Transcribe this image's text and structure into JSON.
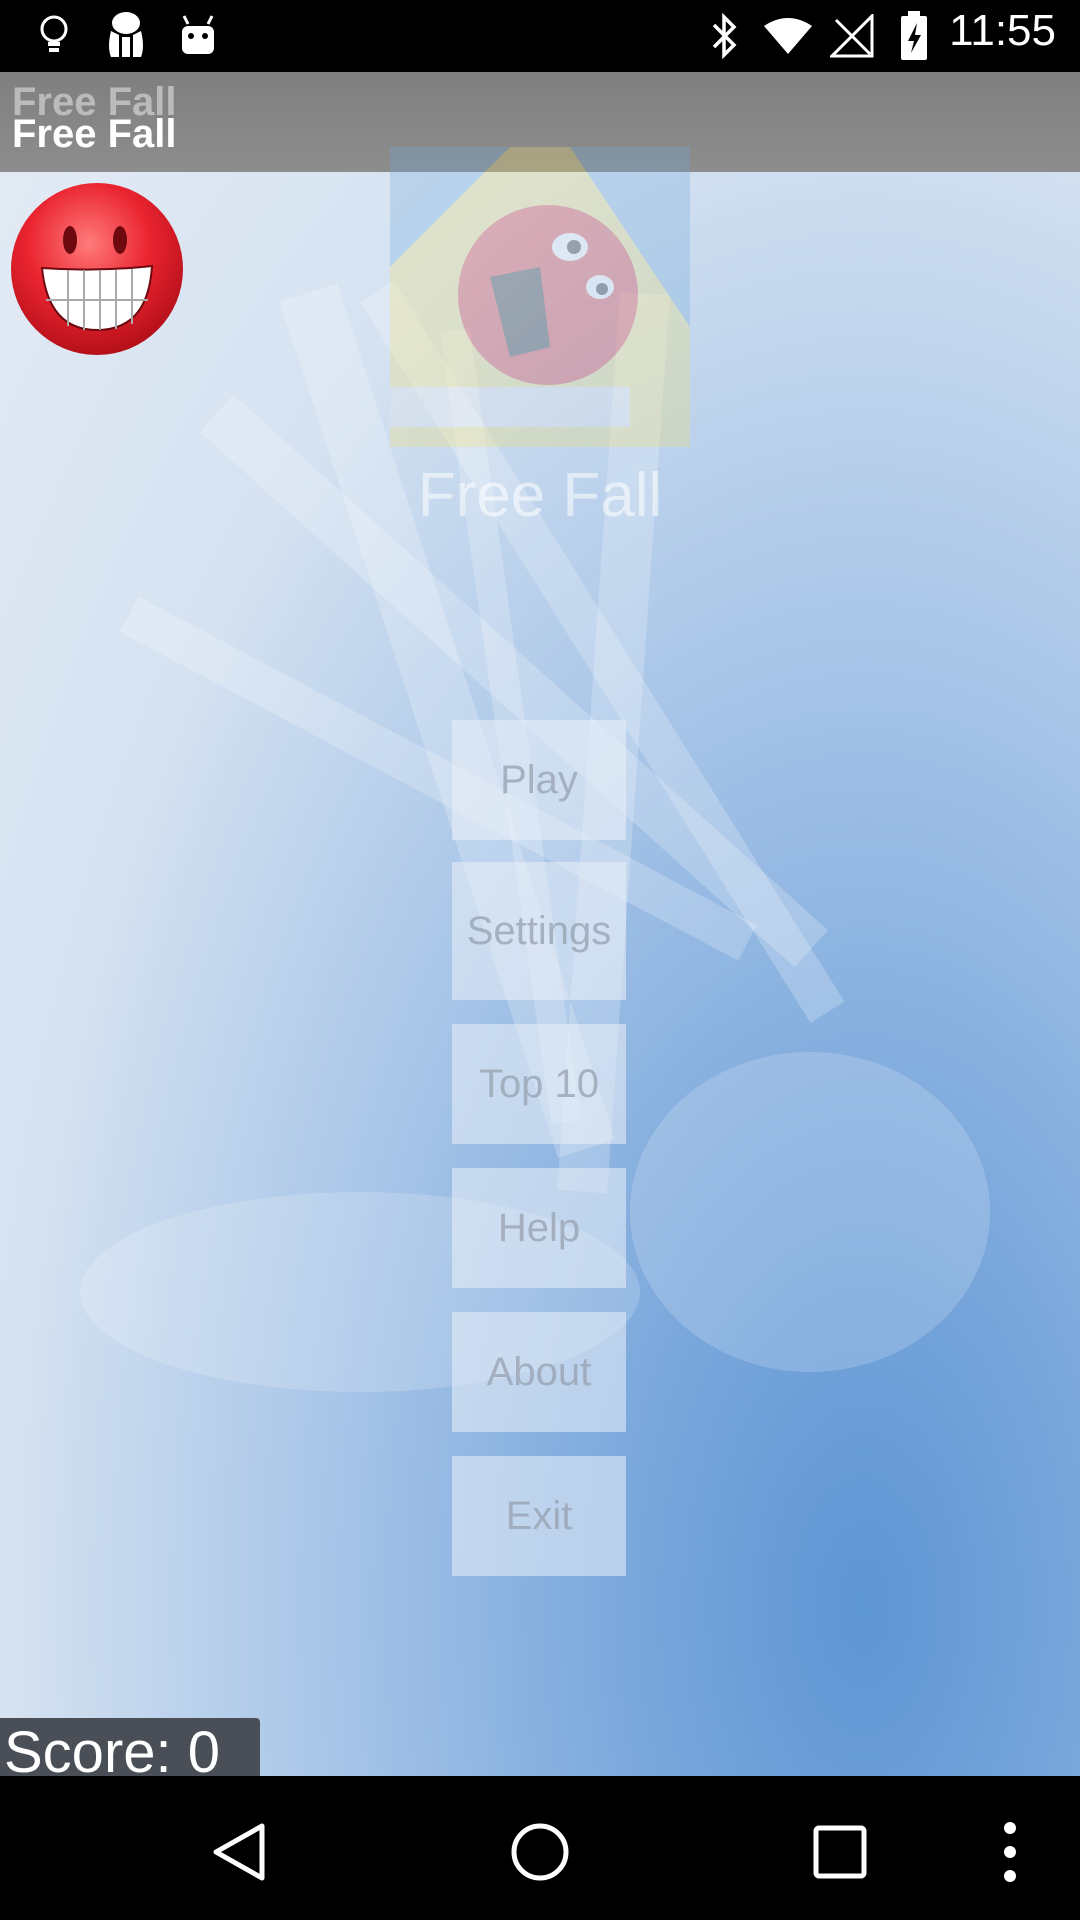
{
  "status_bar": {
    "time": "11:55",
    "icons": [
      "lightbulb-icon",
      "app-notification-icon",
      "android-icon",
      "bluetooth-icon",
      "wifi-icon",
      "no-signal-icon",
      "battery-icon"
    ]
  },
  "app": {
    "title": "Free Fall",
    "title_ghost": "Free Fall",
    "heading": "Free Fall",
    "menu": {
      "play": "Play",
      "settings": "Settings",
      "top10": "Top 10",
      "help": "Help",
      "about": "About",
      "exit": "Exit"
    },
    "score": "Score: 0"
  },
  "colors": {
    "sky_light": "#e4ecf5",
    "sky_dark": "#5e95d4",
    "title_bar": "#858585",
    "smiley_red": "#e8202c"
  },
  "nav_bar": {
    "icons": [
      "back-icon",
      "home-icon",
      "recents-icon",
      "overflow-menu-icon"
    ]
  }
}
